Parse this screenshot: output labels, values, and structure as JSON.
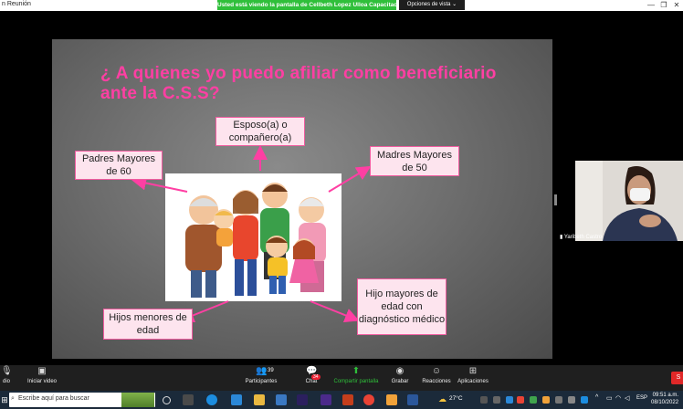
{
  "app": {
    "title": "n Reunión",
    "share_banner": "Usted está viendo la pantalla de Cellbeth Lopez Ulloa Capacitac...",
    "view_options": "Opciones de vista",
    "window_controls": {
      "minimize": "—",
      "restore": "❐",
      "close": "✕"
    }
  },
  "slide": {
    "title": "¿ A quienes yo puedo afiliar como beneficiario ante la C.S.S?",
    "boxes": {
      "esposo": "Esposo(a) o compañero(a)",
      "padres": "Padres Mayores de 60",
      "madres": "Madres Mayores de 50",
      "hijos_menores": "Hijos menores de edad",
      "hijo_mayores": "Hijo mayores de edad con diagnóstico médico"
    },
    "colors": {
      "title": "#ff3fa3",
      "box_fill": "#fde4ee",
      "box_border": "#f05ca0",
      "arrow": "#ff3fa3"
    }
  },
  "participant": {
    "name": "Yaribeth Castro"
  },
  "toolbar": {
    "audio": "dio",
    "video": "Iniciar video",
    "participants": "Participantes",
    "participants_count": "39",
    "chat": "Chat",
    "chat_badge": "34",
    "share": "Compartir pantalla",
    "record": "Grabar",
    "reactions": "Reacciones",
    "apps": "Aplicaciones",
    "end": "S"
  },
  "taskbar": {
    "search_placeholder": "Escribe aquí para buscar",
    "temperature": "27°C",
    "language": "ESP",
    "time": "09:51 a.m.",
    "date": "08/10/2022"
  }
}
